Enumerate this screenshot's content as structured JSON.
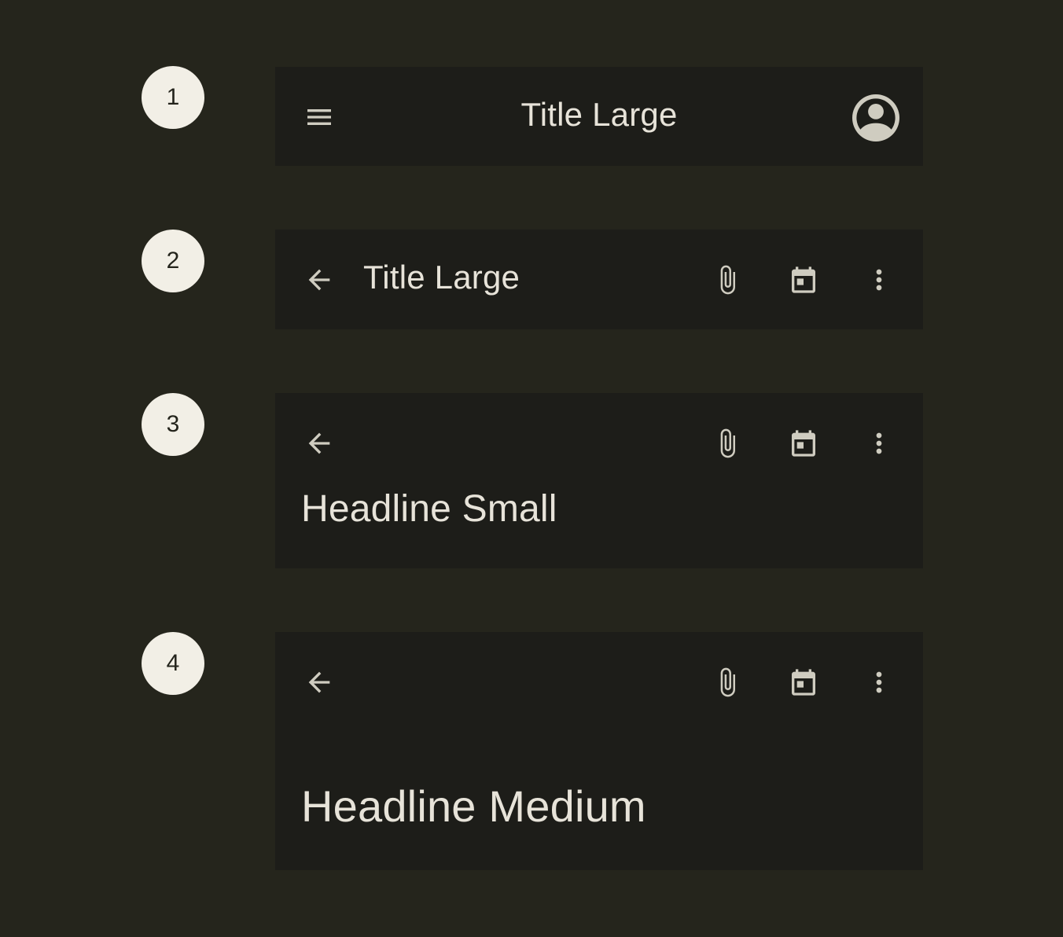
{
  "colors": {
    "background": "#25251c",
    "bar_surface": "#1d1d19",
    "badge_fill": "#f2efe6",
    "badge_text": "#24241c",
    "title_text": "#e7e3d9",
    "icon": "#cfccc0"
  },
  "bars": [
    {
      "badge": "1",
      "title": "Title Large",
      "variant": "center-aligned",
      "leading_icon": "menu-icon",
      "trailing_icons": [
        "account-circle-icon"
      ]
    },
    {
      "badge": "2",
      "title": "Title Large",
      "variant": "small",
      "leading_icon": "arrow-back-icon",
      "trailing_icons": [
        "attach-file-icon",
        "calendar-icon",
        "more-vert-icon"
      ]
    },
    {
      "badge": "3",
      "title": "Headline Small",
      "variant": "medium",
      "leading_icon": "arrow-back-icon",
      "trailing_icons": [
        "attach-file-icon",
        "calendar-icon",
        "more-vert-icon"
      ]
    },
    {
      "badge": "4",
      "title": "Headline Medium",
      "variant": "large",
      "leading_icon": "arrow-back-icon",
      "trailing_icons": [
        "attach-file-icon",
        "calendar-icon",
        "more-vert-icon"
      ]
    }
  ]
}
